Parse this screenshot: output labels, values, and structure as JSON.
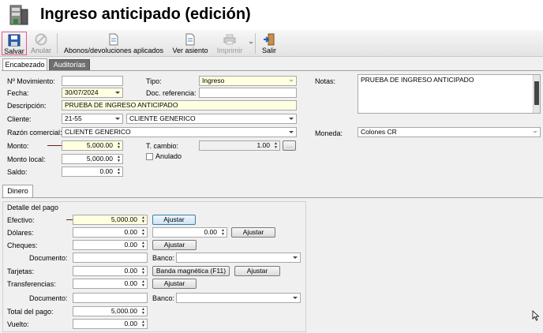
{
  "title": "Ingreso anticipado (edición)",
  "toolbar": {
    "save": "Salvar",
    "void": "Anular",
    "applied": "Abonos/devoluciones aplicados",
    "view_entry": "Ver asiento",
    "print": "Imprimir",
    "exit": "Salir"
  },
  "tabs": {
    "header": "Encabezado",
    "audits": "Auditorías"
  },
  "form": {
    "movement_label": "Nº Movimiento:",
    "movement_value": "",
    "date_label": "Fecha:",
    "date_value": "30/07/2024",
    "description_label": "Descripción:",
    "description_value": "PRUEBA DE INGRESO ANTICIPADO",
    "client_label": "Cliente:",
    "client_code": "21-55",
    "client_name": "CLIENTE GENERICO",
    "trade_name_label": "Razón comercial:",
    "trade_name_value": "CLIENTE GENERICO",
    "amount_label": "Monto:",
    "amount_value": "5,000.00",
    "local_amount_label": "Monto local:",
    "local_amount_value": "5,000.00",
    "balance_label": "Saldo:",
    "balance_value": "0.00",
    "type_label": "Tipo:",
    "type_value": "Ingreso",
    "doc_ref_label": "Doc. referencia:",
    "doc_ref_value": "",
    "exchange_label": "T. cambio:",
    "exchange_value": "1.00",
    "cancelled_label": "Anulado",
    "notes_label": "Notas:",
    "notes_value": "PRUEBA DE INGRESO ANTICIPADO",
    "currency_label": "Moneda:",
    "currency_value": "Colones CR"
  },
  "money_tab": "Dinero",
  "payment": {
    "section_title": "Detalle del pago",
    "cash_label": "Efectivo:",
    "cash_value": "5,000.00",
    "dollars_label": "Dólares:",
    "dollars_value": "0.00",
    "dollars_value2": "0.00",
    "checks_label": "Cheques:",
    "checks_value": "0.00",
    "check_doc_label": "Documento:",
    "check_bank_label": "Banco:",
    "cards_label": "Tarjetas:",
    "cards_value": "0.00",
    "magstripe_button": "Banda magnética (F11)",
    "transfers_label": "Transferencias:",
    "transfers_value": "0.00",
    "transfer_doc_label": "Documento:",
    "transfer_bank_label": "Banco:",
    "total_label": "Total del pago:",
    "total_value": "5,000.00",
    "change_label": "Vuelto:",
    "change_value": "0.00",
    "adjust_button": "Ajustar"
  },
  "colors": {
    "highlight_border": "#e05a8a",
    "yellow_field": "#ffffe1",
    "arrow": "#7a1a1a"
  }
}
